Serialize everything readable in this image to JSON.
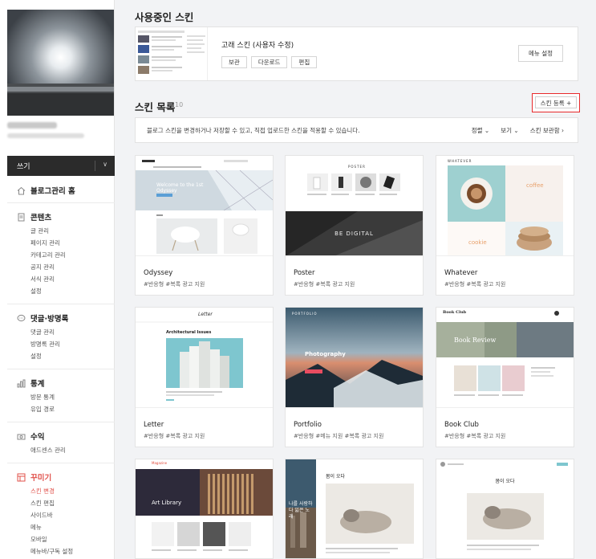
{
  "sidebar": {
    "write_label": "쓰기",
    "sections": [
      {
        "title": "블로그관리 홈",
        "icon": "home-icon",
        "items": []
      },
      {
        "title": "콘텐츠",
        "icon": "document-icon",
        "items": [
          "글 관리",
          "페이지 관리",
          "카테고리 관리",
          "공지 관리",
          "서식 관리",
          "설정"
        ]
      },
      {
        "title": "댓글·방명록",
        "icon": "comment-icon",
        "items": [
          "댓글 관리",
          "방명록 관리",
          "설정"
        ]
      },
      {
        "title": "통계",
        "icon": "chart-icon",
        "items": [
          "방문 통계",
          "유입 경로"
        ]
      },
      {
        "title": "수익",
        "icon": "revenue-icon",
        "items": [
          "애드센스 관리"
        ]
      },
      {
        "title": "꾸미기",
        "icon": "decorate-icon",
        "items": [
          "스킨 변경",
          "스킨 편집",
          "사이드바",
          "메뉴",
          "모바일",
          "메뉴바/구독 설정"
        ]
      }
    ]
  },
  "current": {
    "heading": "사용중인 스킨",
    "skin_name": "고래 스킨 (사용자 수정)",
    "btn_view": "보관",
    "btn_download": "다운로드",
    "btn_edit": "편집",
    "btn_menu": "메뉴 설정"
  },
  "list": {
    "heading": "스킨 목록",
    "count": "10",
    "register": "스킨 등록 +",
    "info": "블로그 스킨을 변경하거나 저장할 수 있고, 직접 업로드한 스킨을 적용할 수 있습니다.",
    "sort": "정렬",
    "view": "보기",
    "archive": "스킨 보관함"
  },
  "skins": [
    {
      "name": "Odyssey",
      "tags": "#반응형   #복록 광고 지원"
    },
    {
      "name": "Poster",
      "tags": "#반응형   #복록 광고 지원"
    },
    {
      "name": "Whatever",
      "tags": "#반응형   #복록 광고 지원"
    },
    {
      "name": "Letter",
      "tags": "#반응형   #복록 광고 지원"
    },
    {
      "name": "Portfolio",
      "tags": "#반응형   #메뉴 지원   #복록 광고 지원"
    },
    {
      "name": "Book Club",
      "tags": "#반응형   #복록 광고 지원"
    }
  ],
  "thumb_text": {
    "odyssey": "Welcome to the 1st Odyssey",
    "poster": "BE DIGITAL",
    "poster_logo": "POSTER",
    "whatever_logo": "WHATEVER",
    "coffee": "coffee",
    "cookie": "cookie",
    "letter_logo": "Letter",
    "letter_title": "Architectural Issues",
    "portfolio": "Photography",
    "portfolio_logo": "PORTFOLIO",
    "book_club": "Book Club",
    "book_review": "Book Review",
    "magazine_logo": "Magazine",
    "art_library": "Art Library",
    "cat_title": "봄이 오다",
    "cat_title2": "봄이 오다",
    "city_title": "나를 사랑하다 잃은 노래"
  },
  "colors": {
    "accent": "#e0504a",
    "highlight_border": "#e8292b"
  }
}
